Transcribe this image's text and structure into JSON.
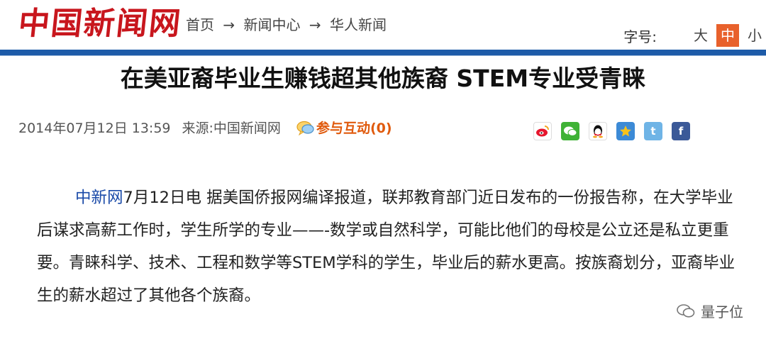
{
  "header": {
    "logo": "中国新闻网",
    "breadcrumb": [
      "首页",
      "新闻中心",
      "华人新闻"
    ],
    "breadcrumb_sep": "→",
    "font_size_label": "字号:",
    "font_size_options": [
      "大",
      "中",
      "小"
    ],
    "font_size_selected": "中"
  },
  "article": {
    "title": "在美亚裔毕业生赚钱超其他族裔 STEM专业受青睐",
    "datetime": "2014年07月12日 13:59",
    "source_label": "来源:",
    "source": "中国新闻网",
    "comments_label": "参与互动(0)",
    "share_icons": [
      "weibo-icon",
      "wechat-icon",
      "qq-icon",
      "qzone-icon",
      "tencent-weibo-icon",
      "facebook-icon"
    ],
    "body_source": "中新网",
    "body_text": "7月12日电 据美国侨报网编译报道，联邦教育部门近日发布的一份报告称，在大学毕业后谋求高薪工作时，学生所学的专业——-数学或自然科学，可能比他们的母校是公立还是私立更重要。青睐科学、技术、工程和数学等STEM学科的学生，毕业后的薪水更高。按族裔划分，亚裔毕业生的薪水超过了其他各个族裔。"
  },
  "watermark": "量子位",
  "colors": {
    "brand_red": "#c8161d",
    "nav_blue": "#1d5ba8",
    "accent_orange": "#e8612c",
    "link_blue": "#1a4aa8"
  }
}
